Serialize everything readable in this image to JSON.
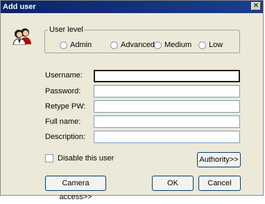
{
  "window": {
    "title": "Add user",
    "close_glyph": "✕"
  },
  "icon": {
    "name": "users-icon"
  },
  "user_level": {
    "legend": "User level",
    "options": [
      {
        "label": "Admin",
        "selected": false
      },
      {
        "label": "Advanced",
        "selected": false
      },
      {
        "label": "Medium",
        "selected": false
      },
      {
        "label": "Low",
        "selected": false
      }
    ]
  },
  "fields": {
    "username": {
      "label": "Username:",
      "value": ""
    },
    "password": {
      "label": "Password:",
      "value": ""
    },
    "retype_pw": {
      "label": "Retype PW:",
      "value": ""
    },
    "full_name": {
      "label": "Full name:",
      "value": ""
    },
    "description": {
      "label": "Description:",
      "value": ""
    }
  },
  "disable_user": {
    "label": "Disable this user",
    "checked": false
  },
  "buttons": {
    "authority": "Authority>>",
    "camera_access": "Camera access>>",
    "ok": "OK",
    "cancel": "Cancel"
  }
}
